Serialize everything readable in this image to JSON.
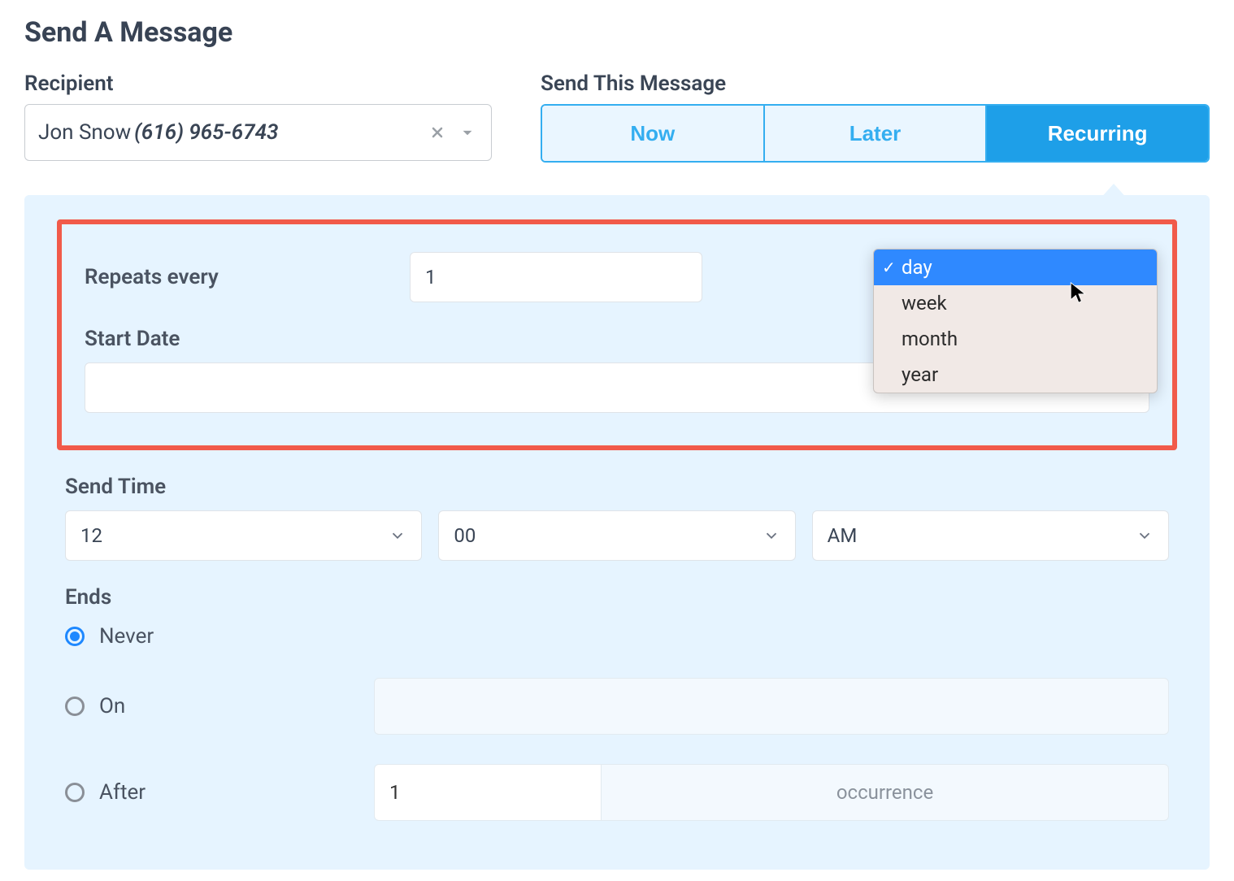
{
  "title": "Send A Message",
  "recipient": {
    "label": "Recipient",
    "name": "Jon Snow",
    "phone": "(616) 965-6743"
  },
  "sendThisMessage": {
    "label": "Send This Message",
    "options": {
      "now": "Now",
      "later": "Later",
      "recurring": "Recurring"
    },
    "active": "recurring"
  },
  "repeats": {
    "label": "Repeats every",
    "value": "1",
    "unitOptions": [
      "day",
      "week",
      "month",
      "year"
    ],
    "selected": "day"
  },
  "startDate": {
    "label": "Start Date",
    "value": ""
  },
  "sendTime": {
    "label": "Send Time",
    "hour": "12",
    "minute": "00",
    "ampm": "AM"
  },
  "ends": {
    "label": "Ends",
    "never": "Never",
    "on": "On",
    "after": "After",
    "afterValue": "1",
    "afterUnit": "occurrence",
    "selected": "never"
  }
}
